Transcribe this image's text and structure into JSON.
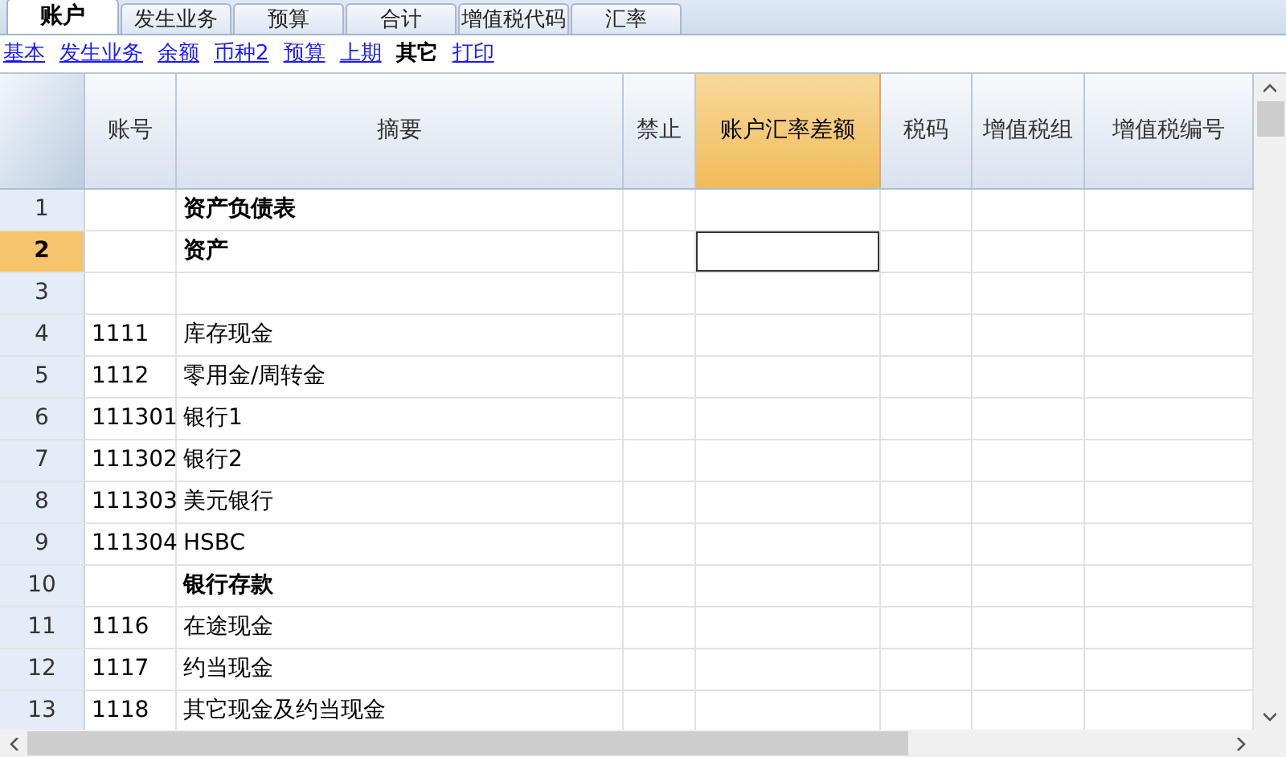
{
  "tabs": [
    {
      "label": "账户",
      "selected": true
    },
    {
      "label": "发生业务",
      "selected": false
    },
    {
      "label": "预算",
      "selected": false
    },
    {
      "label": "合计",
      "selected": false
    },
    {
      "label": "增值税代码",
      "selected": false
    },
    {
      "label": "汇率",
      "selected": false
    }
  ],
  "views": [
    {
      "label": "基本",
      "selected": false
    },
    {
      "label": "发生业务",
      "selected": false
    },
    {
      "label": "余额",
      "selected": false
    },
    {
      "label": "币种2",
      "selected": false
    },
    {
      "label": "预算",
      "selected": false
    },
    {
      "label": "上期",
      "selected": false
    },
    {
      "label": "其它",
      "selected": true
    },
    {
      "label": "打印",
      "selected": false
    }
  ],
  "table": {
    "columns": [
      {
        "label": "账号",
        "selected": false
      },
      {
        "label": "摘要",
        "selected": false
      },
      {
        "label": "禁止",
        "selected": false
      },
      {
        "label": "账户汇率差额",
        "selected": true
      },
      {
        "label": "税码",
        "selected": false
      },
      {
        "label": "增值税组",
        "selected": false
      },
      {
        "label": "增值税编号",
        "selected": false
      }
    ],
    "rows": [
      {
        "number": "1",
        "account": "",
        "description": "资产负债表",
        "bold": true,
        "selected": false
      },
      {
        "number": "2",
        "account": "",
        "description": "资产",
        "bold": true,
        "selected": true
      },
      {
        "number": "3",
        "account": "",
        "description": "",
        "selected": false
      },
      {
        "number": "4",
        "account": "1111",
        "description": "库存现金",
        "bold": false,
        "selected": false
      },
      {
        "number": "5",
        "account": "1112",
        "description": "零用金/周转金",
        "bold": false,
        "selected": false
      },
      {
        "number": "6",
        "account": "111301",
        "description": "银行1",
        "bold": false,
        "selected": false
      },
      {
        "number": "7",
        "account": "111302",
        "description": "银行2",
        "bold": false,
        "selected": false
      },
      {
        "number": "8",
        "account": "111303",
        "description": "美元银行",
        "bold": false,
        "selected": false
      },
      {
        "number": "9",
        "account": "111304",
        "description": "HSBC",
        "bold": false,
        "selected": false
      },
      {
        "number": "10",
        "account": "",
        "description": "银行存款",
        "bold": true,
        "selected": false
      },
      {
        "number": "11",
        "account": "1116",
        "description": "在途现金",
        "bold": false,
        "selected": false
      },
      {
        "number": "12",
        "account": "1117",
        "description": "约当现金",
        "bold": false,
        "selected": false
      },
      {
        "number": "13",
        "account": "1118",
        "description": "其它现金及约当现金",
        "bold": false,
        "selected": false
      }
    ]
  }
}
